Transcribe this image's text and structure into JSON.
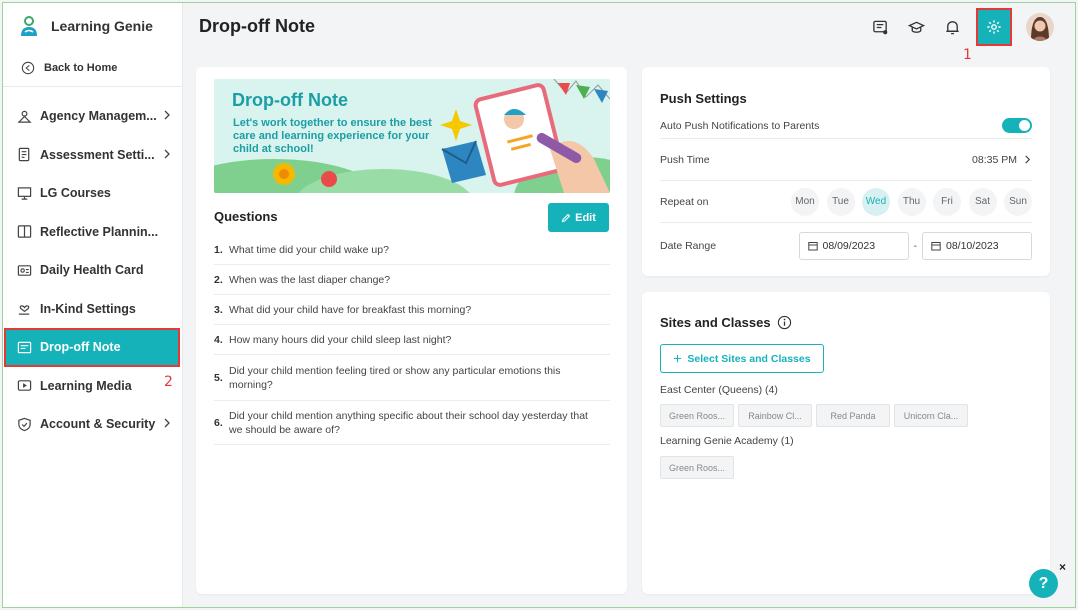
{
  "brand": {
    "name": "Learning Genie"
  },
  "sidebar": {
    "back_label": "Back to Home",
    "items": [
      {
        "label": "Agency Managem...",
        "chevron": true
      },
      {
        "label": "Assessment Setti...",
        "chevron": true
      },
      {
        "label": "LG Courses",
        "chevron": false
      },
      {
        "label": "Reflective Plannin...",
        "chevron": false
      },
      {
        "label": "Daily Health Card",
        "chevron": false
      },
      {
        "label": "In-Kind Settings",
        "chevron": false
      },
      {
        "label": "Drop-off Note",
        "chevron": false,
        "active": true
      },
      {
        "label": "Learning Media",
        "chevron": false
      },
      {
        "label": "Account & Security",
        "chevron": true
      }
    ]
  },
  "markers": {
    "one": "1",
    "two": "2"
  },
  "header": {
    "title": "Drop-off Note"
  },
  "banner": {
    "title": "Drop-off Note",
    "subtitle": "Let's work together to ensure the best care and learning experience for your child at school!"
  },
  "questions": {
    "title": "Questions",
    "edit_label": "Edit",
    "items": [
      {
        "num": "1.",
        "text": "What time did your child wake up?"
      },
      {
        "num": "2.",
        "text": "When was the last diaper change?"
      },
      {
        "num": "3.",
        "text": "What did your child have for breakfast this morning?"
      },
      {
        "num": "4.",
        "text": "How many hours did your child sleep last night?"
      },
      {
        "num": "5.",
        "text": "Did your child mention feeling tired or show any particular emotions this morning?"
      },
      {
        "num": "6.",
        "text": "Did your child mention anything specific about their school day yesterday that we should be aware of?"
      }
    ]
  },
  "push": {
    "title": "Push Settings",
    "auto_label": "Auto Push Notifications to Parents",
    "auto_on": true,
    "time_label": "Push Time",
    "time_value": "08:35 PM",
    "repeat_label": "Repeat on",
    "days": [
      "Mon",
      "Tue",
      "Wed",
      "Thu",
      "Fri",
      "Sat",
      "Sun"
    ],
    "selected_day": "Wed",
    "range_label": "Date Range",
    "range_start": "08/09/2023",
    "range_sep": "-",
    "range_end": "08/10/2023"
  },
  "sites": {
    "title": "Sites and Classes",
    "select_label": "Select Sites and Classes",
    "groups": [
      {
        "label": "East Center (Queens) (4)",
        "classes": [
          "Green Roos...",
          "Rainbow Cl...",
          "Red Panda",
          "Unicorn Cla..."
        ]
      },
      {
        "label": "Learning Genie Academy (1)",
        "classes": [
          "Green Roos..."
        ]
      }
    ]
  },
  "help": {
    "label": "?",
    "close": "×"
  },
  "colors": {
    "accent": "#16b2b9",
    "highlight": "#e53935"
  }
}
